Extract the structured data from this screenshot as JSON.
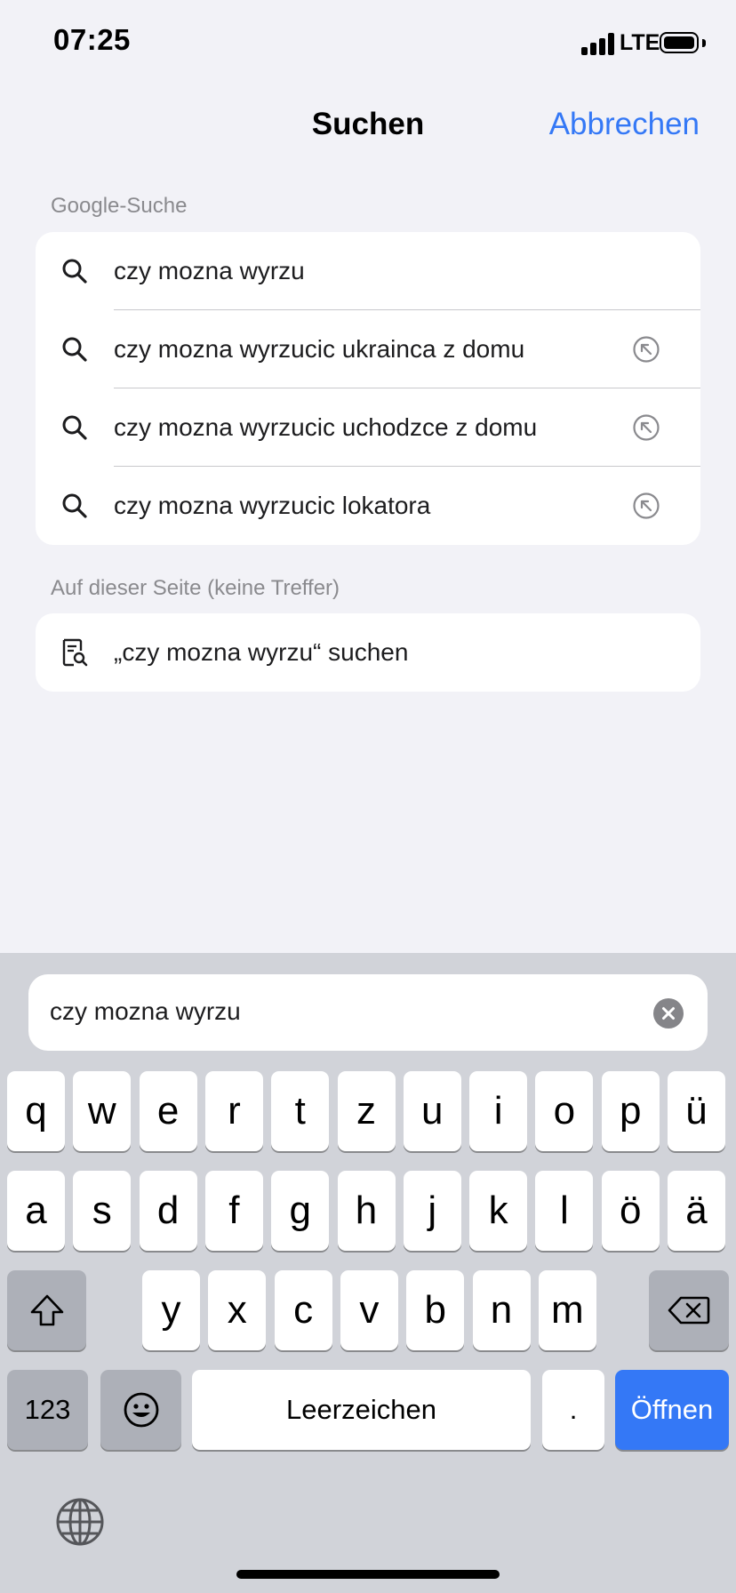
{
  "status_bar": {
    "time": "07:25",
    "network": "LTE"
  },
  "nav": {
    "title": "Suchen",
    "cancel_label": "Abbrechen"
  },
  "google_section": {
    "label": "Google-Suche",
    "suggestions": [
      {
        "text": "czy mozna wyrzu",
        "icon": "search-icon"
      },
      {
        "text": "czy mozna wyrzucic ukrainca z domu",
        "icon": "search-icon",
        "trail_icon": "fill-suggestion-arrow-icon"
      },
      {
        "text": "czy mozna wyrzucic uchodzce z domu",
        "icon": "search-icon",
        "trail_icon": "fill-suggestion-arrow-icon"
      },
      {
        "text": "czy mozna wyrzucic lokatora",
        "icon": "search-icon",
        "trail_icon": "fill-suggestion-arrow-icon"
      }
    ]
  },
  "page_section": {
    "label": "Auf dieser Seite (keine Treffer)",
    "find_text": "„czy mozna wyrzu“ suchen",
    "icon": "find-on-page-icon"
  },
  "search_field": {
    "value": "czy mozna wyrzu"
  },
  "keyboard": {
    "row1": [
      "q",
      "w",
      "e",
      "r",
      "t",
      "z",
      "u",
      "i",
      "o",
      "p",
      "ü"
    ],
    "row2": [
      "a",
      "s",
      "d",
      "f",
      "g",
      "h",
      "j",
      "k",
      "l",
      "ö",
      "ä"
    ],
    "row3": [
      "y",
      "x",
      "c",
      "v",
      "b",
      "n",
      "m"
    ],
    "numbers_label": "123",
    "space_label": "Leerzeichen",
    "period_label": ".",
    "go_label": "Öffnen"
  },
  "colors": {
    "accent": "#3478f6",
    "background": "#f2f2f7",
    "keyboard_bg": "#d1d3d9"
  }
}
